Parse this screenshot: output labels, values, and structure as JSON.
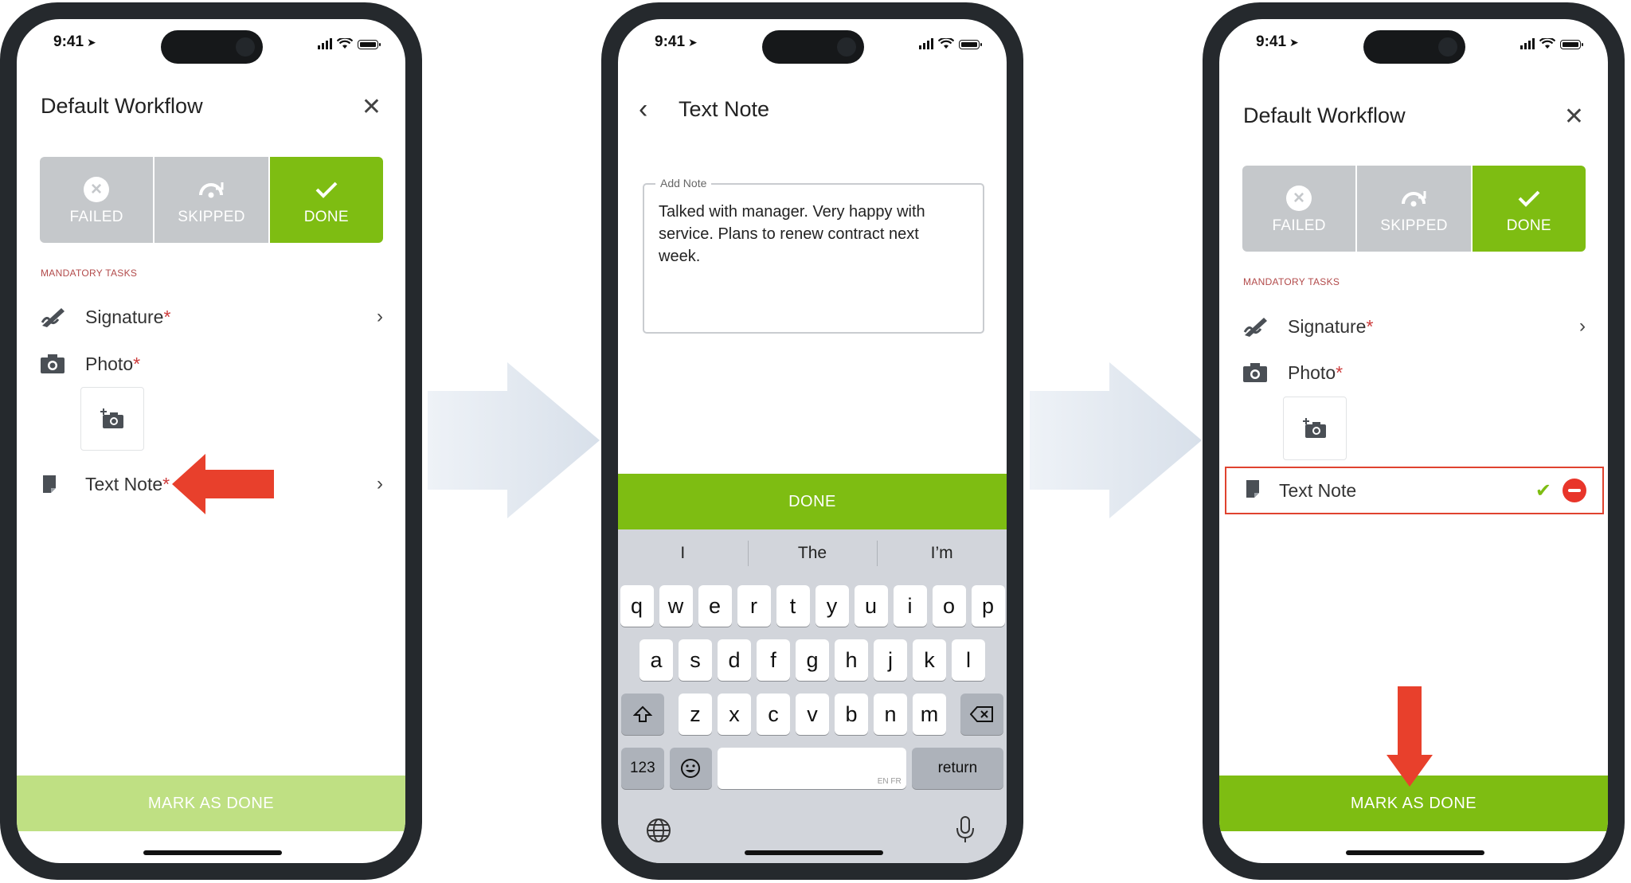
{
  "status": {
    "time": "9:41"
  },
  "colors": {
    "green": "#7ebd12",
    "light_green": "#bfe083",
    "red_arrow": "#e8402c",
    "gray_seg": "#c5c8cb"
  },
  "screen1": {
    "title": "Default Workflow",
    "segments": [
      "FAILED",
      "SKIPPED",
      "DONE"
    ],
    "mandatory_label": "MANDATORY TASKS",
    "tasks": [
      {
        "label": "Signature",
        "req": "*",
        "icon": "signature-icon"
      },
      {
        "label": "Photo",
        "req": "*",
        "icon": "camera-icon"
      },
      {
        "label": "Text Note",
        "req": "*",
        "icon": "note-icon"
      }
    ],
    "mark_done": "MARK AS DONE"
  },
  "screen2": {
    "title": "Text Note",
    "field_legend": "Add Note",
    "note_value": "Talked with manager. Very happy with service. Plans to renew contract next week.",
    "done": "DONE",
    "suggestions": [
      "I",
      "The",
      "I’m"
    ],
    "row1": [
      "q",
      "w",
      "e",
      "r",
      "t",
      "y",
      "u",
      "i",
      "o",
      "p"
    ],
    "row2": [
      "a",
      "s",
      "d",
      "f",
      "g",
      "h",
      "j",
      "k",
      "l"
    ],
    "row3": [
      "z",
      "x",
      "c",
      "v",
      "b",
      "n",
      "m"
    ],
    "key_123": "123",
    "key_return": "return",
    "space_tag": "EN FR"
  },
  "screen3": {
    "title": "Default Workflow",
    "segments": [
      "FAILED",
      "SKIPPED",
      "DONE"
    ],
    "mandatory_label": "MANDATORY TASKS",
    "tasks": [
      {
        "label": "Signature",
        "req": "*"
      },
      {
        "label": "Photo",
        "req": "*"
      },
      {
        "label": "Text Note",
        "req": ""
      }
    ],
    "mark_done": "MARK AS DONE"
  }
}
